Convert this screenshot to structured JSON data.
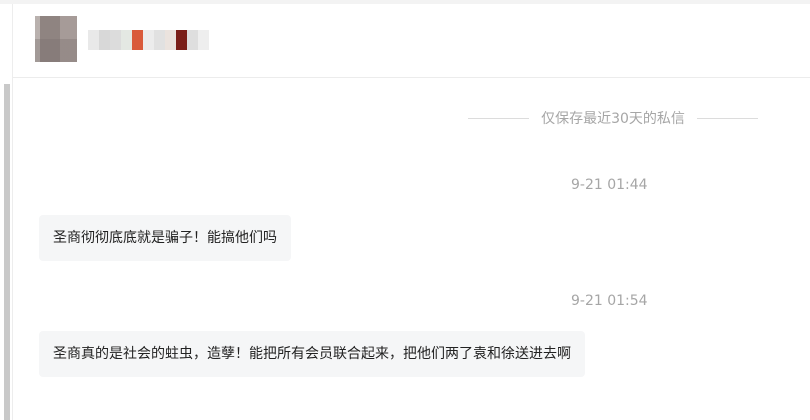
{
  "header": {
    "avatar_icon": "user-avatar-icon",
    "name_blurred": true
  },
  "conversation": {
    "retention_notice": "仅保存最近30天的私信",
    "messages": [
      {
        "time": "9-21 01:44",
        "text": "圣商彻彻底底就是骗子！能搞他们吗"
      },
      {
        "time": "9-21 01:54",
        "text": "圣商真的是社会的蛀虫，造孽！能把所有会员联合起来，把他们两了袁和徐送进去啊"
      }
    ]
  },
  "colors": {
    "bubble_bg": "#f5f6f7",
    "muted_text": "#a6a6a6",
    "scrollbar": "#c9c9c9"
  }
}
